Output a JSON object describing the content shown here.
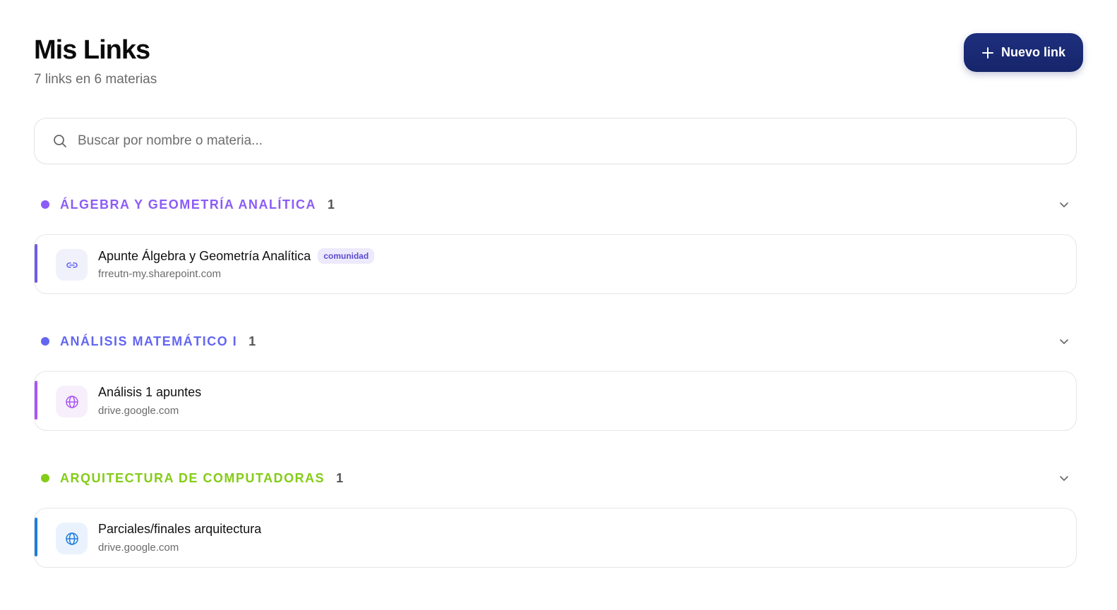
{
  "header": {
    "title": "Mis Links",
    "subtitle": "7 links en 6 materias",
    "new_button_label": "Nuevo link"
  },
  "search": {
    "placeholder": "Buscar por nombre o materia..."
  },
  "groups": [
    {
      "name": "ÁLGEBRA Y GEOMETRÍA ANALÍTICA",
      "count": "1",
      "color": "#8b5cf6",
      "links": [
        {
          "title": "Apunte Álgebra y Geometría Analítica",
          "badge": "comunidad",
          "domain": "frreutn-my.sharepoint.com",
          "icon": "link-icon",
          "accent": "#6d5ce8",
          "icon_bg": "#f1f1fb",
          "icon_color": "#6366f1"
        }
      ]
    },
    {
      "name": "ANÁLISIS MATEMÁTICO I",
      "count": "1",
      "color": "#6366f1",
      "links": [
        {
          "title": "Análisis 1 apuntes",
          "badge": "",
          "domain": "drive.google.com",
          "icon": "globe-icon",
          "accent": "#a855f7",
          "icon_bg": "#f7effc",
          "icon_color": "#a855f7"
        }
      ]
    },
    {
      "name": "ARQUITECTURA DE COMPUTADORAS",
      "count": "1",
      "color": "#84cc16",
      "links": [
        {
          "title": "Parciales/finales arquitectura",
          "badge": "",
          "domain": "drive.google.com",
          "icon": "globe-icon",
          "accent": "#1d7ce0",
          "icon_bg": "#eaf3fd",
          "icon_color": "#1d7ce0"
        }
      ]
    }
  ]
}
